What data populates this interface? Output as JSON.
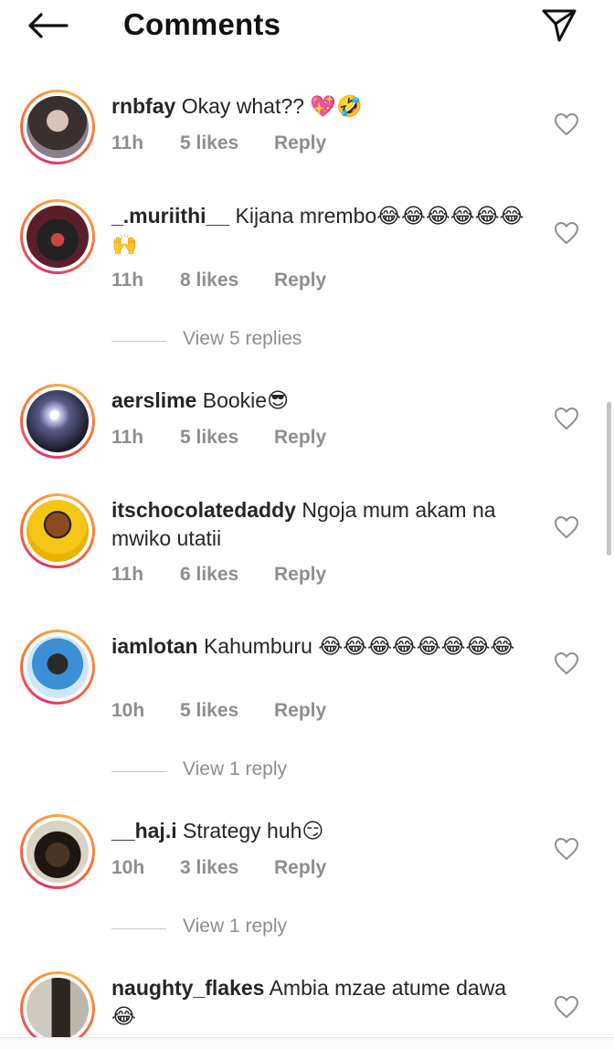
{
  "header": {
    "title": "Comments"
  },
  "colors": {
    "meta_gray": "#8e8e8e",
    "ring_start": "#e1306c",
    "ring_end": "#fcaf45"
  },
  "comments": [
    {
      "user": "rnbfay",
      "text": "Okay what?? 💖🤣",
      "time": "11h",
      "likes": "5 likes",
      "reply": "Reply"
    },
    {
      "user": "_.muriithi__",
      "text": "Kijana mrembo😂😂😂😂😂😂🙌",
      "time": "11h",
      "likes": "8 likes",
      "reply": "Reply",
      "view_replies": "View 5 replies"
    },
    {
      "user": "aerslime",
      "text": "Bookie😎",
      "time": "11h",
      "likes": "5 likes",
      "reply": "Reply"
    },
    {
      "user": "itschocolatedaddy",
      "text": "Ngoja mum akam na mwiko utatii",
      "time": "11h",
      "likes": "6 likes",
      "reply": "Reply"
    },
    {
      "user": "iamlotan",
      "text": "Kahumburu 😂😂😂😂😂😂😂😂",
      "time": "10h",
      "likes": "5 likes",
      "reply": "Reply",
      "view_replies": "View 1 reply"
    },
    {
      "user": "__haj.i",
      "text": "Strategy huh😏",
      "time": "10h",
      "likes": "3 likes",
      "reply": "Reply",
      "view_replies": "View 1 reply"
    },
    {
      "user": "naughty_flakes",
      "text": "Ambia mzae atume dawa😂"
    }
  ]
}
